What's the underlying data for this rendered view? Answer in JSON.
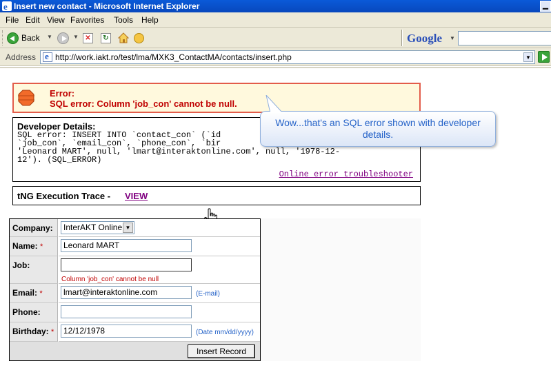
{
  "window": {
    "title": "Insert new contact - Microsoft Internet Explorer"
  },
  "menu": {
    "items": [
      "File",
      "Edit",
      "View",
      "Favorites",
      "Tools",
      "Help"
    ]
  },
  "toolbar": {
    "back_label": "Back",
    "search_brand": "Google"
  },
  "address": {
    "label": "Address",
    "url": "http://work.iakt.ro/test/lma/MXK3_ContactMA/contacts/insert.php"
  },
  "error": {
    "heading": "Error:",
    "message": "SQL error: Column 'job_con' cannot be null."
  },
  "developer": {
    "title": "Developer Details:",
    "lines": [
      "SQL error: INSERT INTO `contact_con` (`id",
      "`job_con`, `email_con`, `phone_con`, `bir",
      "'Leonard MART', null, 'lmart@interaktonline.com', null, '1978-12-",
      "12'). (SQL_ERROR)"
    ],
    "troubleshooter_link": "Online error troubleshooter"
  },
  "callout": {
    "text": "Wow...that's an SQL error shown with developer details."
  },
  "trace": {
    "label": "tNG Execution Trace - ",
    "link": "VIEW"
  },
  "form": {
    "company": {
      "label": "Company:",
      "value": "InterAKT Online"
    },
    "name": {
      "label": "Name:",
      "value": "Leonard MART",
      "required": "*"
    },
    "job": {
      "label": "Job:",
      "value": "",
      "error": "Column 'job_con' cannot be null"
    },
    "email": {
      "label": "Email:",
      "value": "lmart@interaktonline.com",
      "required": "*",
      "hint": "(E-mail)"
    },
    "phone": {
      "label": "Phone:",
      "value": ""
    },
    "birthday": {
      "label": "Birthday:",
      "value": "12/12/1978",
      "required": "*",
      "hint": "(Date mm/dd/yyyy)"
    },
    "submit_label": "Insert Record"
  },
  "colors": {
    "error_text": "#c00000",
    "error_border": "#e35c4a",
    "error_bg": "#fff9dd",
    "link_visited": "#800080",
    "callout_text": "#2462c8"
  }
}
